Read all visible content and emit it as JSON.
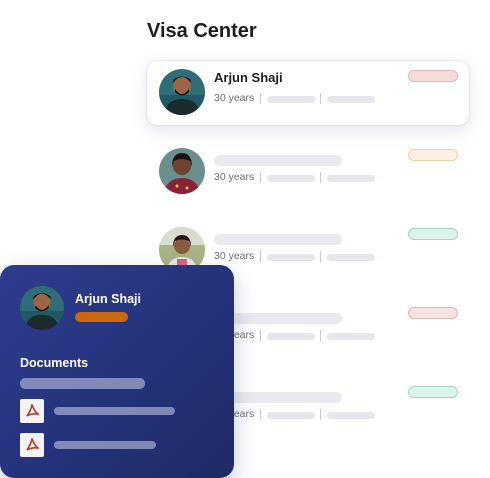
{
  "page": {
    "title": "Visa Center"
  },
  "list": [
    {
      "name": "Arjun Shaji",
      "age": "30 years",
      "status_color": "#f5dcdc",
      "status_border": "#e9b4b4",
      "selected": true
    },
    {
      "name": "",
      "age": "30 years",
      "status_color": "#fdefe2",
      "status_border": "#f3cfa8"
    },
    {
      "name": "",
      "age": "30 years",
      "status_color": "#dcf2ea",
      "status_border": "#9fd6c0"
    },
    {
      "name": "",
      "age": "30 years",
      "status_color": "#f7e1e1",
      "status_border": "#e4b5b5"
    },
    {
      "name": "",
      "age": "30 years",
      "status_color": "#def3ea",
      "status_border": "#a6d9c4"
    }
  ],
  "card": {
    "name": "Arjun Shaji",
    "tag_color": "#c9680f",
    "documents_title": "Documents",
    "document_icons": [
      "pdf-icon",
      "pdf-icon"
    ]
  }
}
